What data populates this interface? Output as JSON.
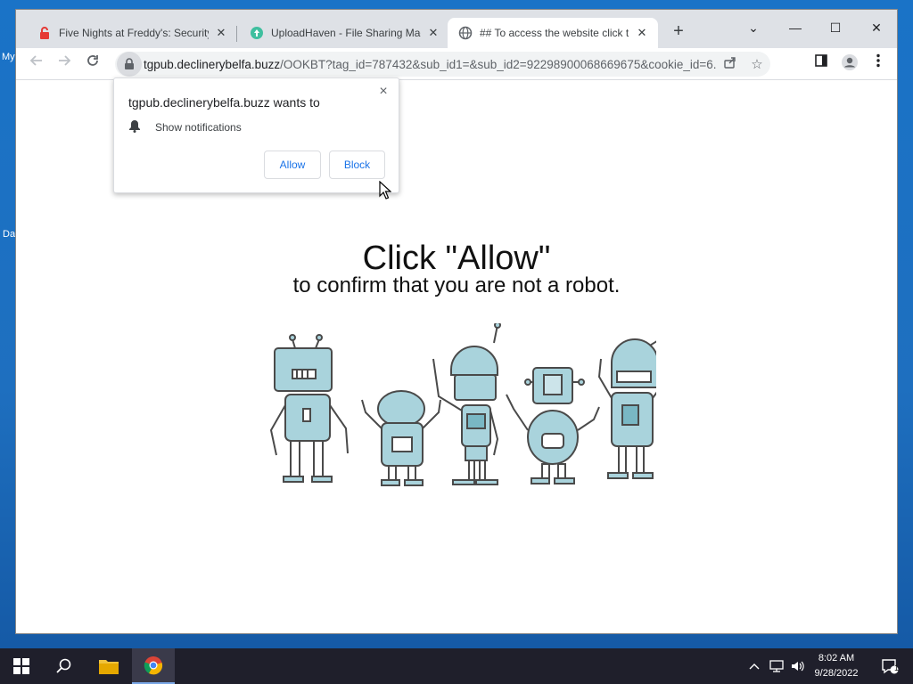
{
  "desktop": {
    "labels": [
      "My",
      "Da"
    ]
  },
  "browser": {
    "tabs": [
      {
        "title": "Five Nights at Freddy's: Security",
        "icon": "red-lock-favicon",
        "active": false
      },
      {
        "title": "UploadHaven - File Sharing Mad",
        "icon": "uploadhaven-favicon",
        "active": false
      },
      {
        "title": "## To access the website click th",
        "icon": "globe-icon",
        "active": true
      }
    ],
    "new_tab": "+",
    "window_controls": {
      "tab_search": "⌄",
      "minimize": "—",
      "maximize": "☐",
      "close": "✕"
    },
    "address": {
      "host": "tgpub.declinerybelfa.buzz",
      "path": "/OOKBT?tag_id=787432&sub_id1=&sub_id2=92298900068669675&cookie_id=6..."
    }
  },
  "permission_popup": {
    "title": "tgpub.declinerybelfa.buzz wants to",
    "permission": "Show notifications",
    "allow_label": "Allow",
    "block_label": "Block",
    "close": "×"
  },
  "page": {
    "headline": "Click \"Allow\"",
    "subline": "to confirm that you are not a robot."
  },
  "taskbar": {
    "time": "8:02 AM",
    "date": "9/28/2022",
    "notification_count": "1"
  },
  "colors": {
    "robot_fill": "#a9d3dc",
    "robot_stroke": "#4a4a4a",
    "accent": "#1a73e8"
  }
}
